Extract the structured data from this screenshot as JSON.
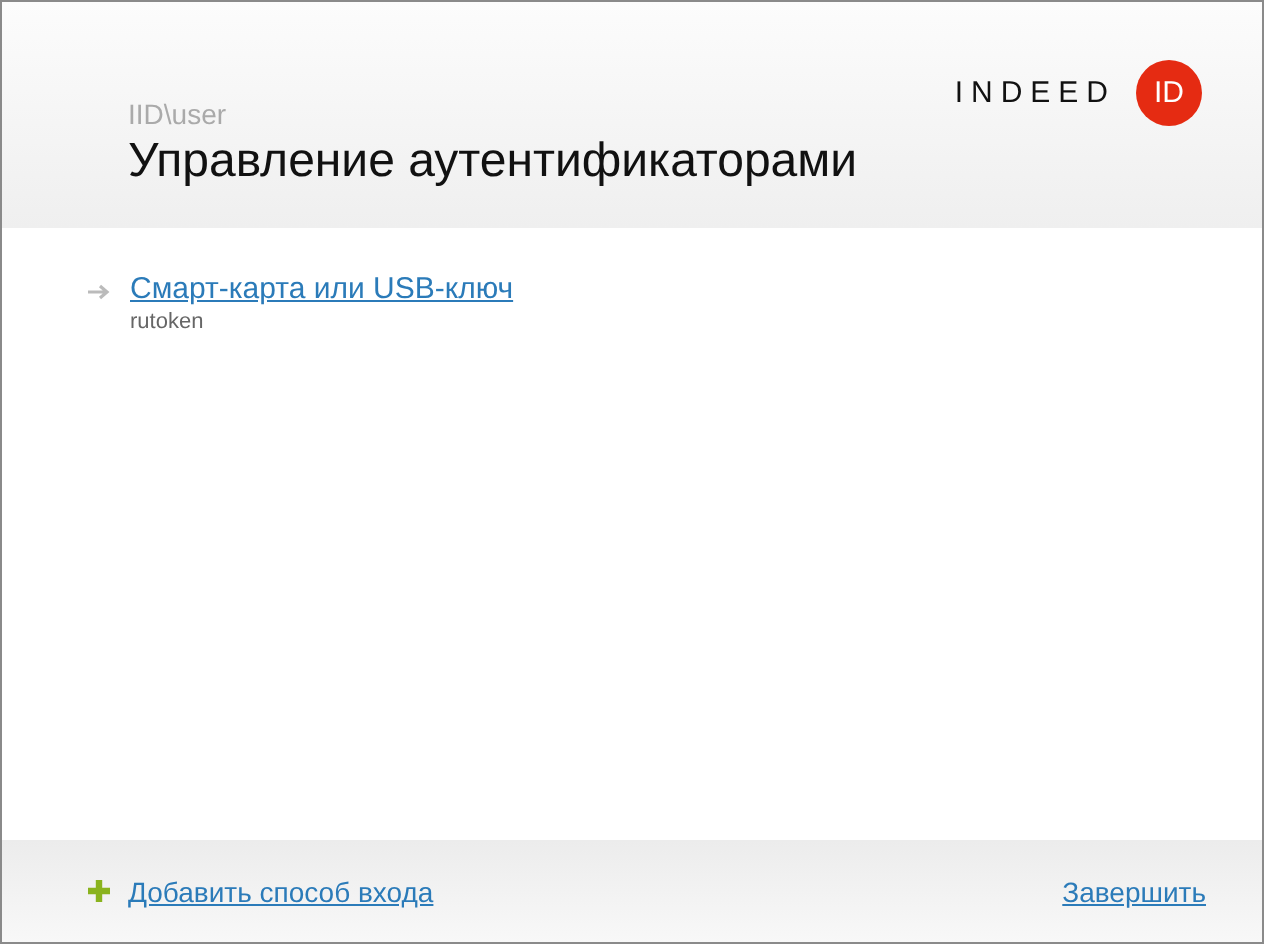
{
  "header": {
    "user": "IID\\user",
    "title": "Управление аутентификаторами",
    "logo": {
      "word": "INDEED",
      "badge": "ID"
    }
  },
  "authenticators": [
    {
      "name": "Смарт-карта или USB-ключ",
      "detail": "rutoken"
    }
  ],
  "footer": {
    "add_link": "Добавить способ входа",
    "finish_link": "Завершить"
  }
}
